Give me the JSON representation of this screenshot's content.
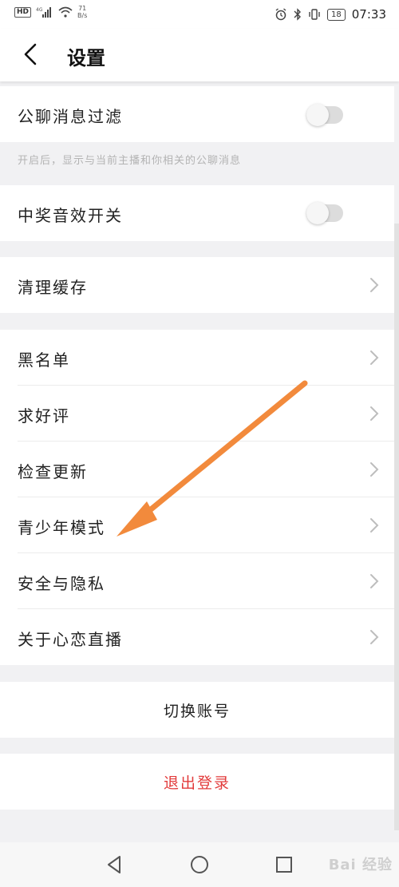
{
  "status_bar": {
    "hd": "HD",
    "net_speed": "71",
    "net_unit": "B/s",
    "battery": "18",
    "time": "07:33"
  },
  "header": {
    "title": "设置"
  },
  "settings": {
    "public_filter_label": "公聊消息过滤",
    "public_filter_hint": "开启后，显示与当前主播和你相关的公聊消息",
    "prize_sound_label": "中奖音效开关",
    "clear_cache_label": "清理缓存",
    "blacklist_label": "黑名单",
    "rate_label": "求好评",
    "check_update_label": "检查更新",
    "teen_mode_label": "青少年模式",
    "privacy_label": "安全与隐私",
    "about_label": "关于心恋直播",
    "switch_account_label": "切换账号",
    "logout_label": "退出登录"
  },
  "toggles": {
    "public_filter_on": false,
    "prize_sound_on": false
  },
  "colors": {
    "logout": "#e23b3b",
    "annotation_arrow": "#f28a3c"
  },
  "watermark": "Bai 经验"
}
